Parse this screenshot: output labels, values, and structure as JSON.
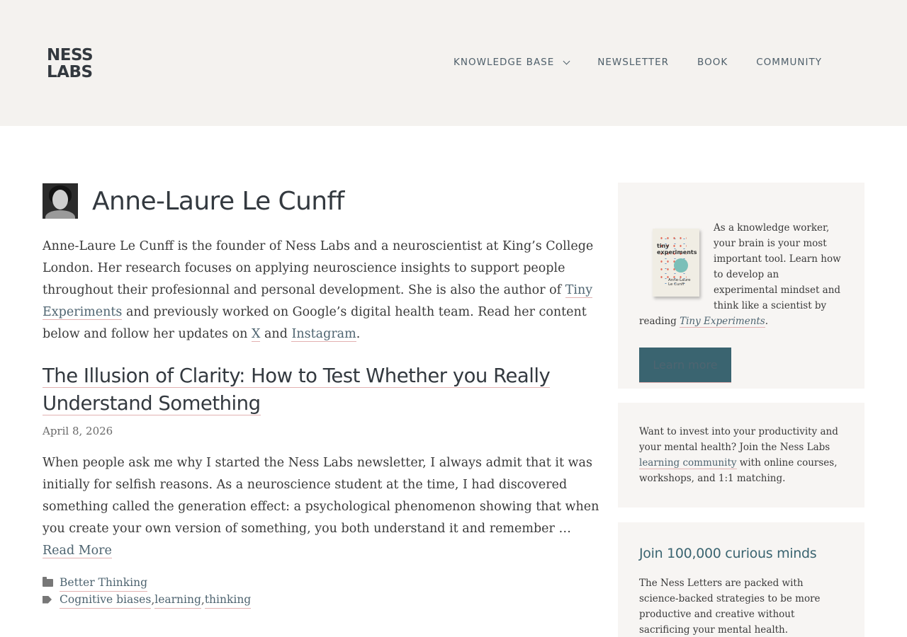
{
  "header": {
    "logo_line1": "NESS",
    "logo_line2": "LABS",
    "nav": [
      {
        "label": "KNOWLEDGE BASE",
        "has_dropdown": true
      },
      {
        "label": "NEWSLETTER"
      },
      {
        "label": "BOOK"
      },
      {
        "label": "COMMUNITY"
      }
    ]
  },
  "author": {
    "name": "Anne-Laure Le Cunff",
    "bio_part1": "Anne-Laure Le Cunff is the founder of Ness Labs and a neuroscientist at King’s College London. Her research focuses on applying neuroscience insights to support people throughout their profesionnal and personal development. She is also the author of ",
    "bio_link1": "Tiny Experiments",
    "bio_part2": " and previously worked on Google’s digital health team. Read her content below and follow her updates on ",
    "bio_link2": "X",
    "bio_part3": " and ",
    "bio_link3": "Instagram",
    "bio_part4": "."
  },
  "post": {
    "title": "The Illusion of Clarity: How to Test Whether you Really Understand Something",
    "date": "April 8, 2026",
    "excerpt": "When people ask me why I started the Ness Labs newsletter, I always admit that it was initially for selfish reasons. As a neuroscience student at the time, I had discovered something called the generation effect: a psychological phenomenon showing that when you create your own version of something, you both understand it and remember … ",
    "read_more": "Read More",
    "category": "Better Thinking",
    "tags": [
      "Cognitive biases",
      "learning",
      "thinking"
    ],
    "tag_sep": ", "
  },
  "sidebar": {
    "book_cover": {
      "title_line1": "tiny",
      "title_line2": "experiments",
      "author_line1": "Anne-Laure",
      "author_line2": "Le Cunff"
    },
    "card1_text": "As a knowledge worker, your brain is your most important tool. Learn how to develop an experimental mindset and think like a scientist by reading ",
    "card1_link": "Tiny Experiments",
    "card1_end": ".",
    "learn_more": "Learn more",
    "card2_text1": "Want to invest into your productivity and your mental health? Join the Ness Labs ",
    "card2_link": "learning community",
    "card2_text2": " with online courses, workshops, and 1:1 matching.",
    "card3_title": "Join 100,000 curious minds",
    "card3_text": "The Ness Letters are packed with science-backed strategies to be more productive and creative without sacrificing your mental health."
  },
  "colors": {
    "header_bg": "#f4f2ef",
    "accent": "#3a6470",
    "link_underline": "#e2b1b1",
    "card_bg": "#f7f5f3"
  }
}
